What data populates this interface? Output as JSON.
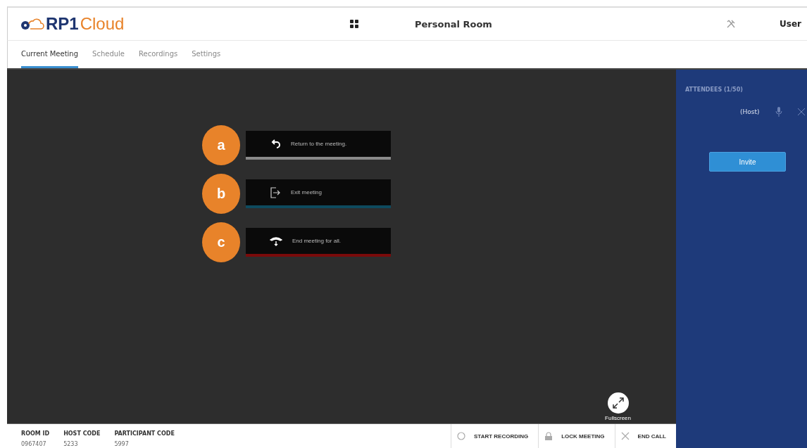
{
  "header": {
    "logo": {
      "brand": "RP1",
      "suffix": "Cloud"
    },
    "title": "Personal Room",
    "user": "User"
  },
  "tabs": [
    {
      "label": "Current Meeting",
      "selected": true
    },
    {
      "label": "Schedule",
      "selected": false
    },
    {
      "label": "Recordings",
      "selected": false
    },
    {
      "label": "Settings",
      "selected": false
    }
  ],
  "options": [
    {
      "marker": "a",
      "kind": "return",
      "label": "Return to the meeting.",
      "color": "#8a8a8a"
    },
    {
      "marker": "b",
      "kind": "exit",
      "label": "Exit meeting",
      "color": "#0e4a5e"
    },
    {
      "marker": "c",
      "kind": "end",
      "label": "End meeting for all.",
      "color": "#7a0a0a"
    }
  ],
  "fullscreen": {
    "label": "Fullscreen"
  },
  "info": [
    {
      "label": "ROOM ID",
      "value": "0967407"
    },
    {
      "label": "HOST CODE",
      "value": "5233"
    },
    {
      "label": "PARTICIPANT CODE",
      "value": "5997"
    }
  ],
  "actions": [
    {
      "kind": "record",
      "label": "START RECORDING"
    },
    {
      "kind": "lock",
      "label": "LOCK MEETING"
    },
    {
      "kind": "end",
      "label": "END CALL"
    }
  ],
  "sidebar": {
    "heading": "ATTENDEES (1/50)",
    "attendees": [
      {
        "name": "(Host)"
      }
    ],
    "invite": "Invite"
  }
}
